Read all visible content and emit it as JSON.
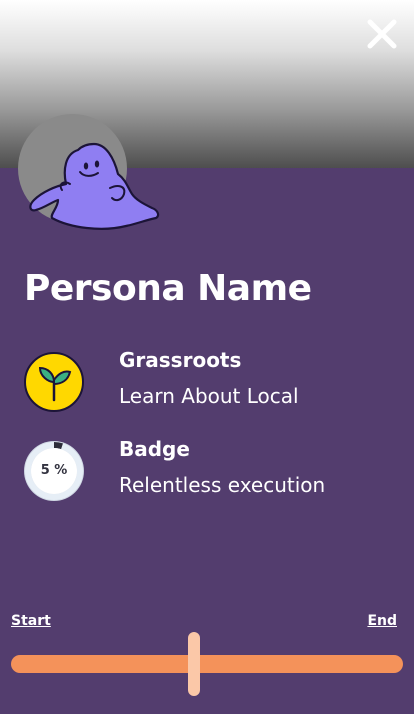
{
  "header": {
    "close_icon": "close-icon"
  },
  "persona": {
    "name": "Persona Name",
    "avatar_icon": "purple-blob-character"
  },
  "rows": [
    {
      "title": "Grassroots",
      "subtitle": "Learn About Local",
      "icon": "sprout-icon",
      "icon_bg": "#ffd800"
    },
    {
      "title": "Badge",
      "subtitle": "Relentless execution",
      "icon": "progress-ring",
      "progress_label": "5 %",
      "progress": 0.05
    }
  ],
  "slider": {
    "start_label": "Start",
    "end_label": "End",
    "value": 0.5,
    "track_color": "#f4925a",
    "thumb_color": "#fbc8a8"
  },
  "colors": {
    "background": "#533d6e",
    "avatar": "#8f7ef2"
  }
}
